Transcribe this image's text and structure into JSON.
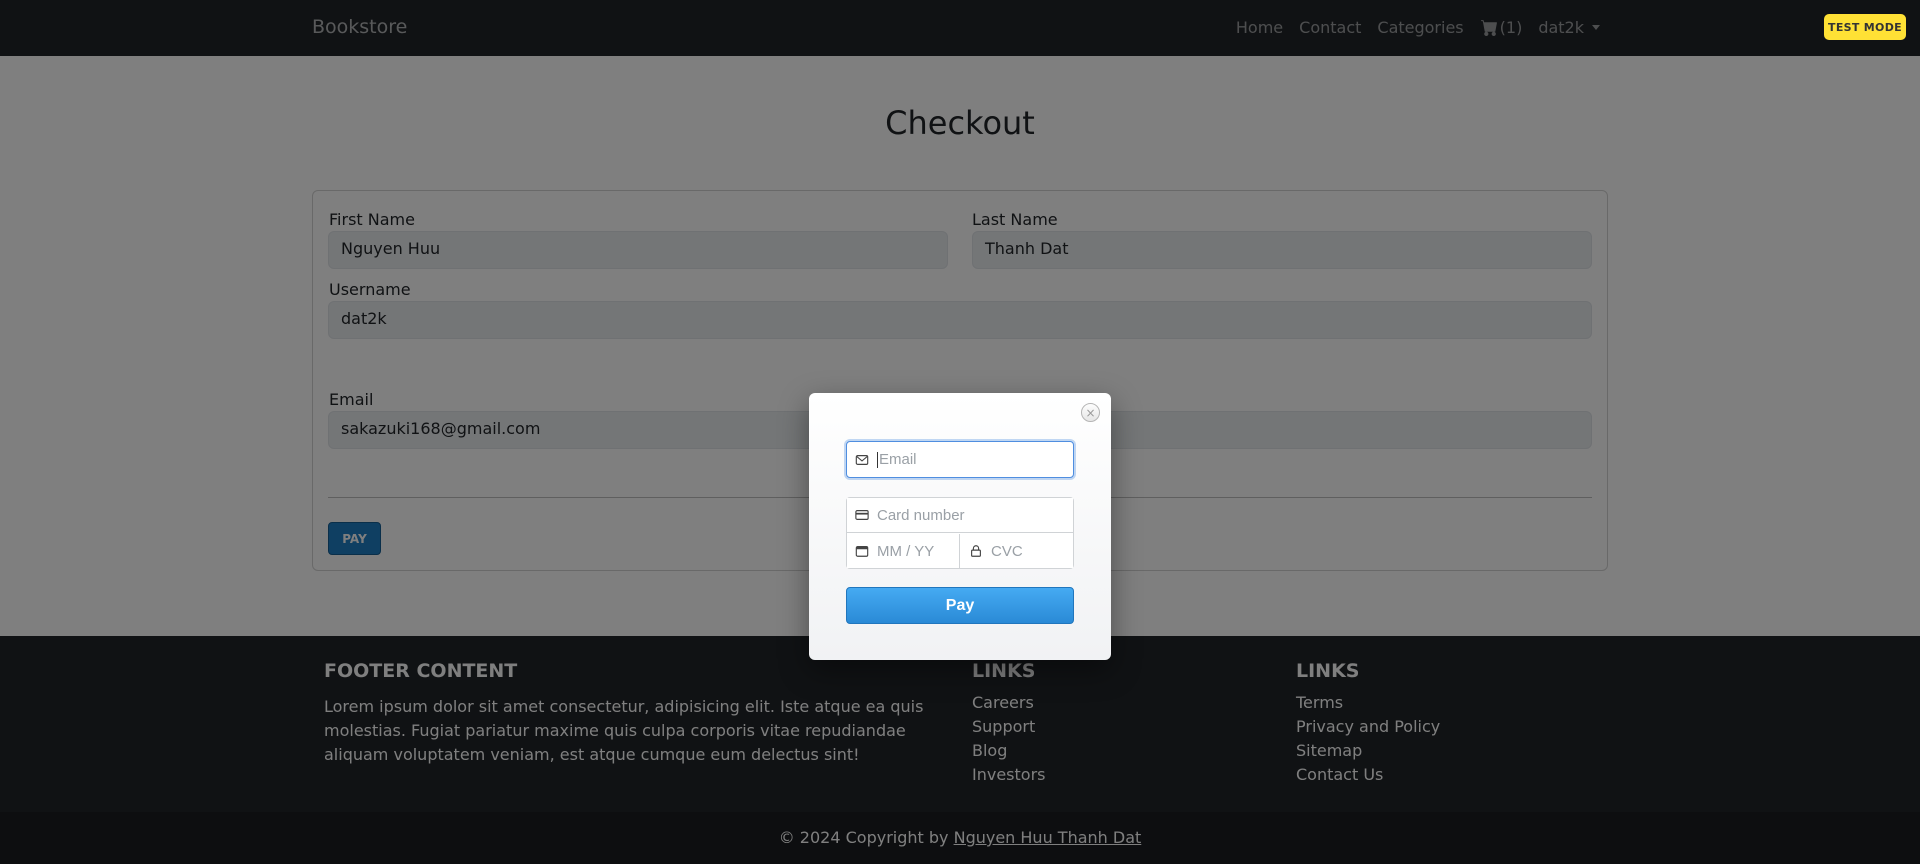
{
  "navbar": {
    "brand": "Bookstore",
    "links": [
      "Home",
      "Contact",
      "Categories"
    ],
    "cart_count": "(1)",
    "user": "dat2k"
  },
  "page": {
    "title": "Checkout",
    "fields": {
      "first_name": {
        "label": "First Name",
        "value": "Nguyen Huu"
      },
      "last_name": {
        "label": "Last Name",
        "value": "Thanh Dat"
      },
      "username": {
        "label": "Username",
        "value": "dat2k"
      },
      "email": {
        "label": "Email",
        "value": "sakazuki168@gmail.com"
      }
    },
    "pay_label": "PAY"
  },
  "footer": {
    "content_title": "FOOTER CONTENT",
    "content_text": "Lorem ipsum dolor sit amet consectetur, adipisicing elit. Iste atque ea quis molestias. Fugiat pariatur maxime quis culpa corporis vitae repudiandae aliquam voluptatem veniam, est atque cumque eum delectus sint!",
    "links1_title": "LINKS",
    "links1": [
      "Careers",
      "Support",
      "Blog",
      "Investors"
    ],
    "links2_title": "LINKS",
    "links2": [
      "Terms",
      "Privacy and Policy",
      "Sitemap",
      "Contact Us"
    ],
    "copyright_prefix": "© 2024 Copyright by",
    "copyright_author": "Nguyen Huu Thanh Dat"
  },
  "test_mode": "TEST MODE",
  "modal": {
    "email_placeholder": "Email",
    "card_number_placeholder": "Card number",
    "expiry_placeholder": "MM / YY",
    "cvc_placeholder": "CVC",
    "pay_button": "Pay",
    "icons": [
      "close-icon",
      "mail-icon",
      "credit-card-icon",
      "calendar-icon",
      "lock-icon"
    ]
  },
  "colors": {
    "navbar": "#212529",
    "pay_button": "#2a8ad6",
    "test_mode_badge": "#ffe135",
    "focus_ring": "#4f8ee0"
  }
}
